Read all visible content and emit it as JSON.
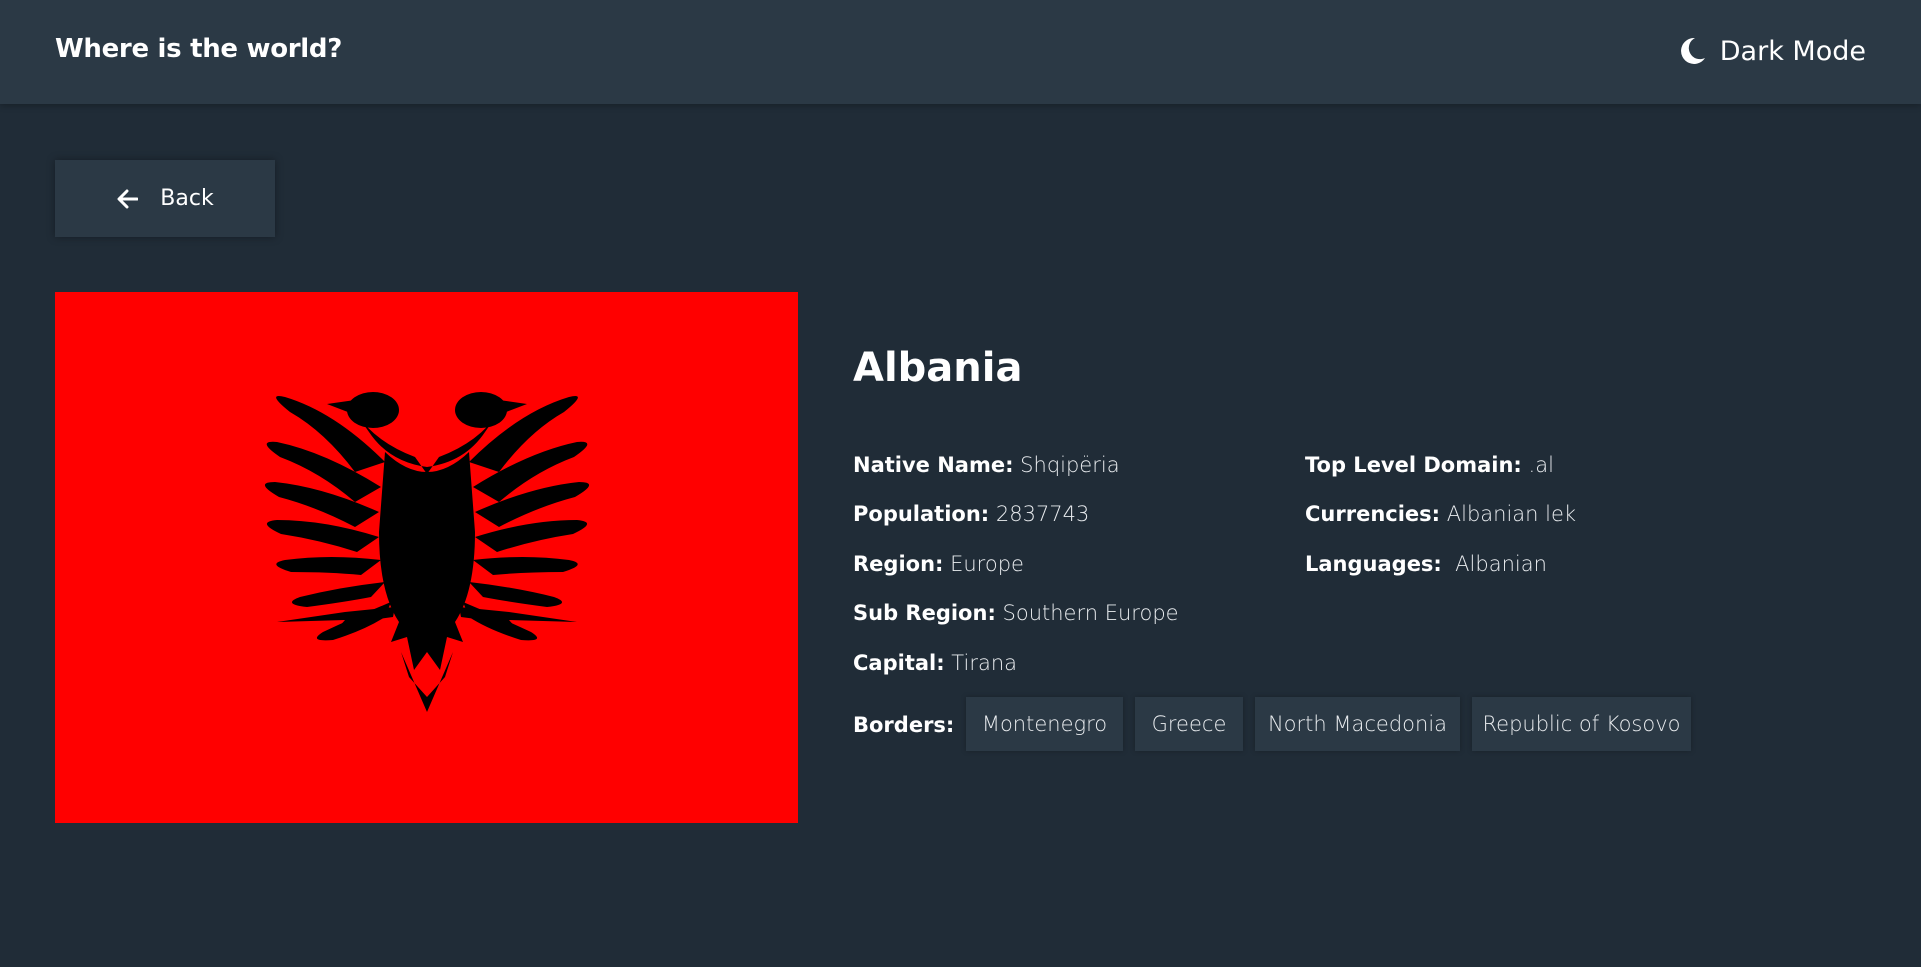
{
  "header": {
    "title": "Where is the world?",
    "theme_toggle_label": "Dark Mode",
    "theme_icon": "moon-icon"
  },
  "back_button": {
    "label": "Back",
    "icon": "arrow-left-icon"
  },
  "country": {
    "name": "Albania",
    "flag": {
      "description_icon": "albania-flag",
      "colors": {
        "field": "#ff0000",
        "emblem": "#000000"
      }
    },
    "left_column": [
      {
        "key": "Native Name:",
        "value": " Shqipëria"
      },
      {
        "key": "Population:",
        "value": " 2837743"
      },
      {
        "key": "Region:",
        "value": " Europe"
      },
      {
        "key": "Sub Region:",
        "value": " Southern Europe"
      },
      {
        "key": "Capital:",
        "value": " Tirana"
      }
    ],
    "right_column": [
      {
        "key": "Top Level Domain:",
        "value": " .al"
      },
      {
        "key": "Currencies:",
        "value": " Albanian lek"
      },
      {
        "key": "Languages:",
        "value": "  Albanian"
      }
    ],
    "borders_label": "Borders:",
    "borders": [
      "Montenegro",
      "Greece",
      "North Macedonia",
      "Republic of Kosovo"
    ]
  },
  "colors": {
    "background": "#202c37",
    "surface": "#2b3945",
    "text": "#ffffff"
  }
}
